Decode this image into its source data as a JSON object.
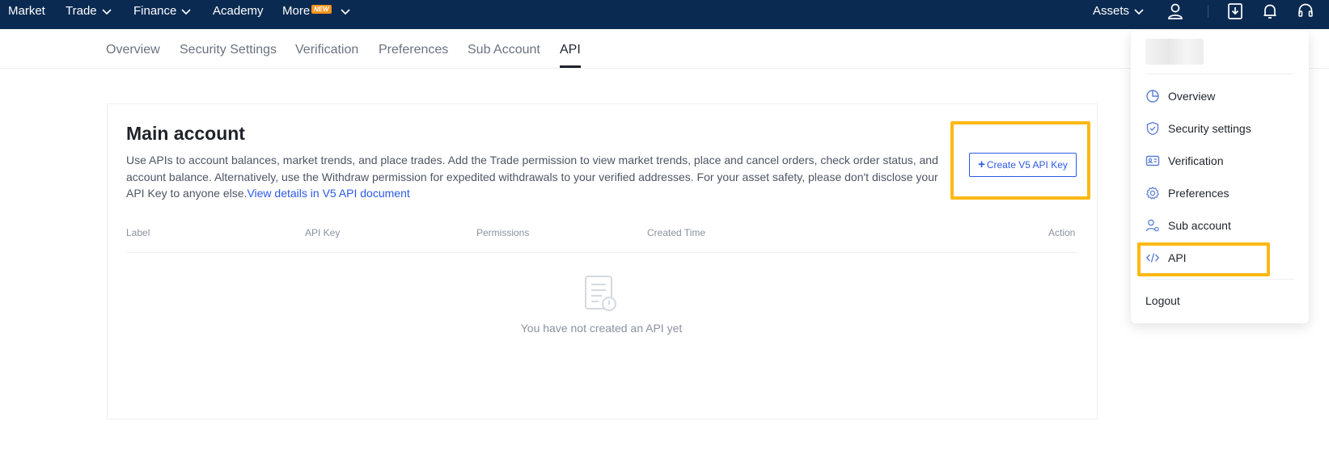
{
  "topnav": {
    "market": "Market",
    "trade": "Trade",
    "finance": "Finance",
    "academy": "Academy",
    "more": "More",
    "new_badge": "NEW",
    "assets": "Assets"
  },
  "subnav": {
    "tabs": [
      {
        "label": "Overview"
      },
      {
        "label": "Security Settings"
      },
      {
        "label": "Verification"
      },
      {
        "label": "Preferences"
      },
      {
        "label": "Sub Account"
      },
      {
        "label": "API"
      }
    ],
    "active": "API"
  },
  "main": {
    "title": "Main account",
    "description": "Use APIs to account balances, market trends, and place trades. Add the Trade permission to view market trends, place and cancel orders, check order status, and account balance. Alternatively, use the Withdraw permission for expedited withdrawals to your verified addresses. For your asset safety, please don't disclose your API Key to anyone else.",
    "doc_link": "View details in V5 API document",
    "create_button": "Create V5 API Key",
    "table_headers": [
      "Label",
      "API Key",
      "Permissions",
      "Created Time",
      "Action"
    ],
    "empty_text": "You have not created an API yet"
  },
  "dropdown": {
    "items": [
      {
        "label": "Overview",
        "icon": "pie-chart-icon"
      },
      {
        "label": "Security settings",
        "icon": "shield-icon"
      },
      {
        "label": "Verification",
        "icon": "id-card-icon"
      },
      {
        "label": "Preferences",
        "icon": "gear-icon"
      },
      {
        "label": "Sub account",
        "icon": "users-icon"
      },
      {
        "label": "API",
        "icon": "code-icon"
      }
    ],
    "logout": "Logout"
  },
  "colors": {
    "topbar": "#0a2a52",
    "accent": "#2b59e6",
    "highlight": "#fcb813"
  }
}
